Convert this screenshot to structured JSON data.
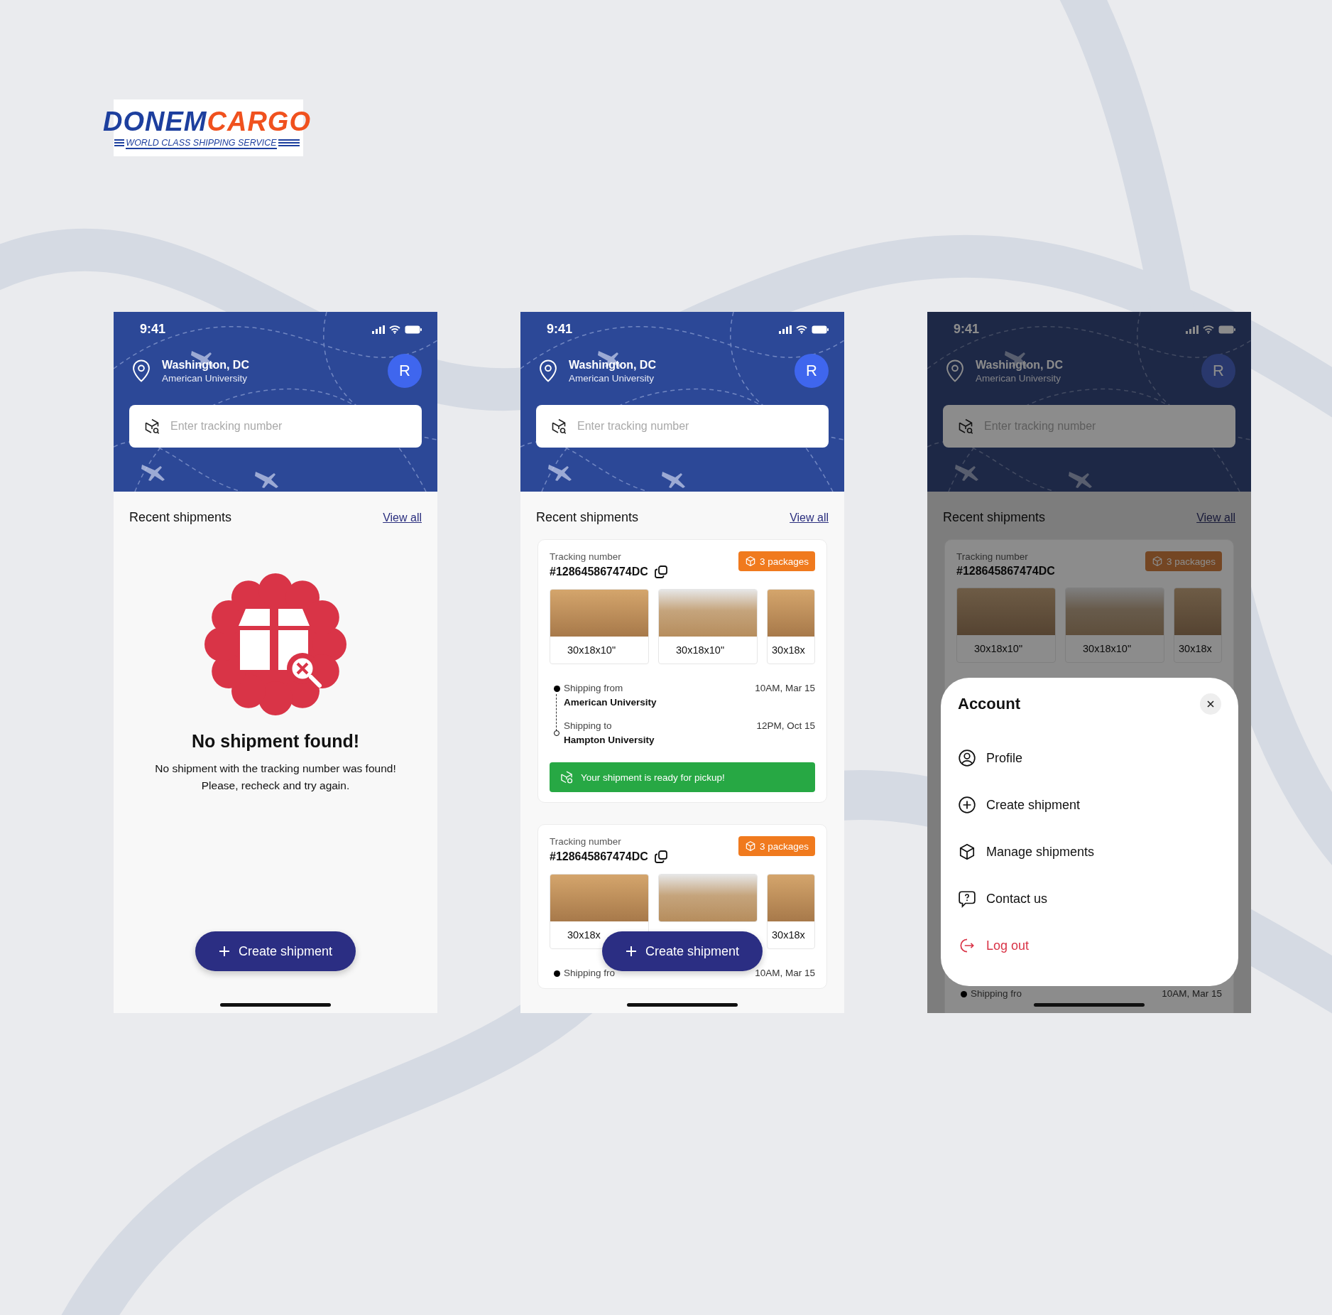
{
  "logo": {
    "name_parts": [
      "DONEM",
      "CARGO"
    ],
    "tagline": "WORLD CLASS SHIPPING SERVICE"
  },
  "screens": [
    {
      "kind": "empty",
      "time": "9:41",
      "location": {
        "city": "Washington, DC",
        "place": "American University"
      },
      "avatar": "R",
      "search": {
        "placeholder": "Enter tracking number"
      },
      "section_title": "Recent shipments",
      "view_all": "View all",
      "empty": {
        "title": "No shipment found!",
        "message_lines": [
          "No shipment with the tracking number was found!",
          "Please, recheck and try again."
        ]
      },
      "create_button": "Create shipment"
    },
    {
      "kind": "list",
      "time": "9:41",
      "location": {
        "city": "Washington, DC",
        "place": "American University"
      },
      "avatar": "R",
      "search": {
        "placeholder": "Enter tracking number"
      },
      "section_title": "Recent shipments",
      "view_all": "View all",
      "shipments": [
        {
          "tracking_label": "Tracking number",
          "number": "#128645867474DC",
          "copyable": true,
          "packages": "3 packages",
          "photos": [
            {
              "size": "30x18x10\""
            },
            {
              "size": "30x18x10\""
            },
            {
              "size": "30x18x"
            }
          ],
          "stops": [
            {
              "kind": "from",
              "label": "Shipping from",
              "place": "American University",
              "time": "10AM, Mar 15"
            },
            {
              "kind": "to",
              "label": "Shipping to",
              "place": "Hampton University",
              "time": "12PM, Oct 15"
            }
          ],
          "status": "Your shipment is ready for pickup!"
        },
        {
          "tracking_label": "Tracking number",
          "number": "#128645867474DC",
          "copyable": true,
          "packages": "3 packages",
          "photos": [
            {
              "size": "30x18x"
            },
            {
              "covered": true
            },
            {
              "size": "30x18x"
            }
          ],
          "stops": [
            {
              "kind": "from",
              "label": "Shipping fro",
              "time": "10AM, Mar 15"
            }
          ]
        }
      ],
      "create_button": "Create shipment"
    },
    {
      "kind": "menu",
      "dimmed": true,
      "time": "9:41",
      "location": {
        "city": "Washington, DC",
        "place": "American University"
      },
      "avatar": "R",
      "search": {
        "placeholder": "Enter tracking number"
      },
      "section_title": "Recent shipments",
      "view_all": "View all",
      "shipments": [
        {
          "tracking_label": "Tracking number",
          "number": "#128645867474DC",
          "copyable": false,
          "packages": "3 packages",
          "photos": [
            {
              "size": "30x18x10\""
            },
            {
              "size": "30x18x10\""
            },
            {
              "size": "30x18x"
            }
          ],
          "stops": [
            {
              "kind": "from",
              "label": "Shipping fro",
              "time": "10AM, Mar 15"
            }
          ]
        }
      ],
      "menu": {
        "title": "Account",
        "items": [
          {
            "kind": "profile",
            "label": "Profile",
            "danger": false
          },
          {
            "kind": "create",
            "label": "Create shipment",
            "danger": false
          },
          {
            "kind": "manage",
            "label": "Manage shipments",
            "danger": false
          },
          {
            "kind": "contact",
            "label": "Contact us",
            "danger": false
          },
          {
            "kind": "logout",
            "label": "Log out",
            "danger": true
          }
        ]
      }
    }
  ]
}
